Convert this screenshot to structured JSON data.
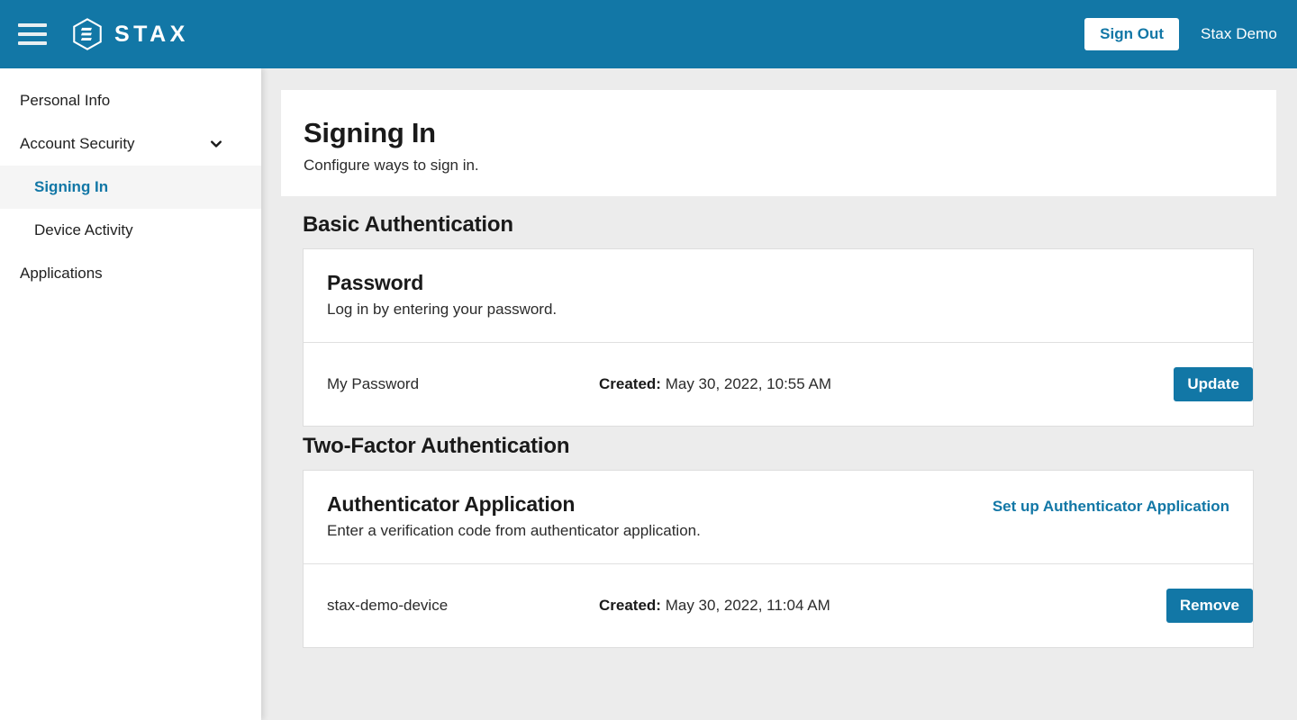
{
  "header": {
    "menu_icon": "hamburger-menu-icon",
    "logo_icon": "stax-hexagon-logo-icon",
    "brand": "STAX",
    "sign_out_label": "Sign Out",
    "user_name": "Stax Demo",
    "background_color": "#1277a6"
  },
  "sidebar": {
    "items": [
      {
        "label": "Personal Info",
        "type": "link",
        "active": false
      },
      {
        "label": "Account Security",
        "type": "group",
        "active": false,
        "icon": "chevron-down-icon"
      },
      {
        "label": "Signing In",
        "type": "child",
        "active": true
      },
      {
        "label": "Device Activity",
        "type": "child",
        "active": false
      },
      {
        "label": "Applications",
        "type": "link",
        "active": false
      }
    ],
    "active_color": "#1277a6",
    "active_background": "#f5f5f5"
  },
  "page": {
    "title": "Signing In",
    "subtitle": "Configure ways to sign in."
  },
  "sections": [
    {
      "title": "Basic Authentication",
      "card": {
        "heading": "Password",
        "description": "Log in by entering your password.",
        "action_link": null,
        "row": {
          "name": "My Password",
          "meta_label": "Created:",
          "meta_value": "May 30, 2022, 10:55 AM",
          "button_label": "Update"
        }
      }
    },
    {
      "title": "Two-Factor Authentication",
      "card": {
        "heading": "Authenticator Application",
        "description": "Enter a verification code from authenticator application.",
        "action_link": "Set up Authenticator Application",
        "row": {
          "name": "stax-demo-device",
          "meta_label": "Created:",
          "meta_value": "May 30, 2022, 11:04 AM",
          "button_label": "Remove"
        }
      }
    }
  ],
  "colors": {
    "brand_blue": "#1277a6",
    "page_background": "#ececec",
    "card_background": "#ffffff",
    "card_border": "#dedede",
    "text_primary": "#1a1a1a",
    "text_secondary": "#2b2b2b"
  }
}
